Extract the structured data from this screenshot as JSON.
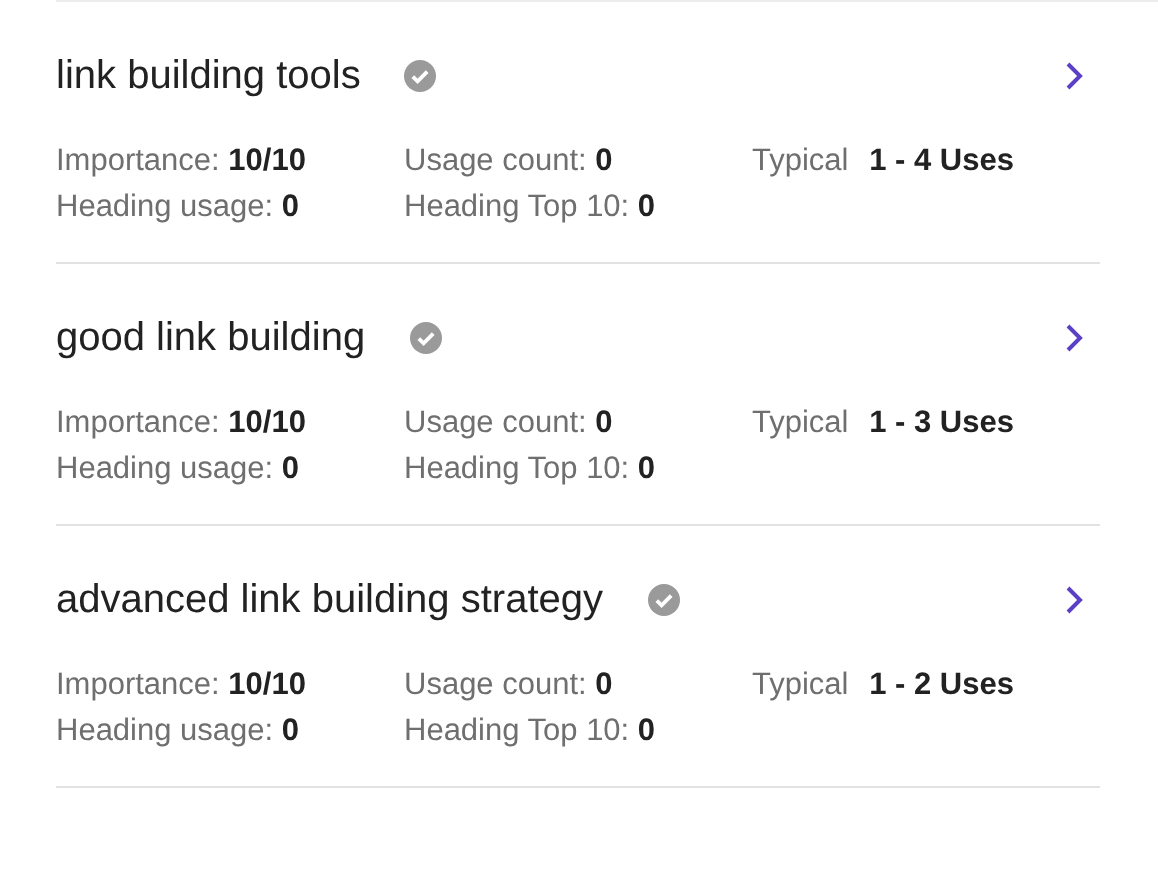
{
  "keywords": [
    {
      "title": "link building tools",
      "verified": true,
      "stats": [
        {
          "kind": "plain",
          "text": "Importance: **10/10**"
        },
        {
          "kind": "plain",
          "text": "Usage count: **0**"
        },
        {
          "kind": "typical",
          "text": "Typical **1 - 4 Uses**"
        },
        {
          "kind": "plain",
          "text": "Heading usage: **0**"
        },
        {
          "kind": "plain",
          "text": "Heading Top 10: **0**"
        }
      ]
    },
    {
      "title": "good link building",
      "verified": true,
      "stats": [
        {
          "kind": "plain",
          "text": "Importance: **10/10**"
        },
        {
          "kind": "plain",
          "text": "Usage count: **0**"
        },
        {
          "kind": "typical",
          "text": "Typical **1 - 3 Uses**"
        },
        {
          "kind": "plain",
          "text": "Heading usage: **0**"
        },
        {
          "kind": "plain",
          "text": "Heading Top 10: **0**"
        }
      ]
    },
    {
      "title": "advanced link building strategy",
      "verified": true,
      "stats": [
        {
          "kind": "plain",
          "text": "Importance: **10/10**"
        },
        {
          "kind": "plain",
          "text": "Usage count: **0**"
        },
        {
          "kind": "typical",
          "text": "Typical **1 - 2 Uses**"
        },
        {
          "kind": "plain",
          "text": "Heading usage: **0**"
        },
        {
          "kind": "plain",
          "text": "Heading Top 10: **0**"
        }
      ]
    }
  ]
}
